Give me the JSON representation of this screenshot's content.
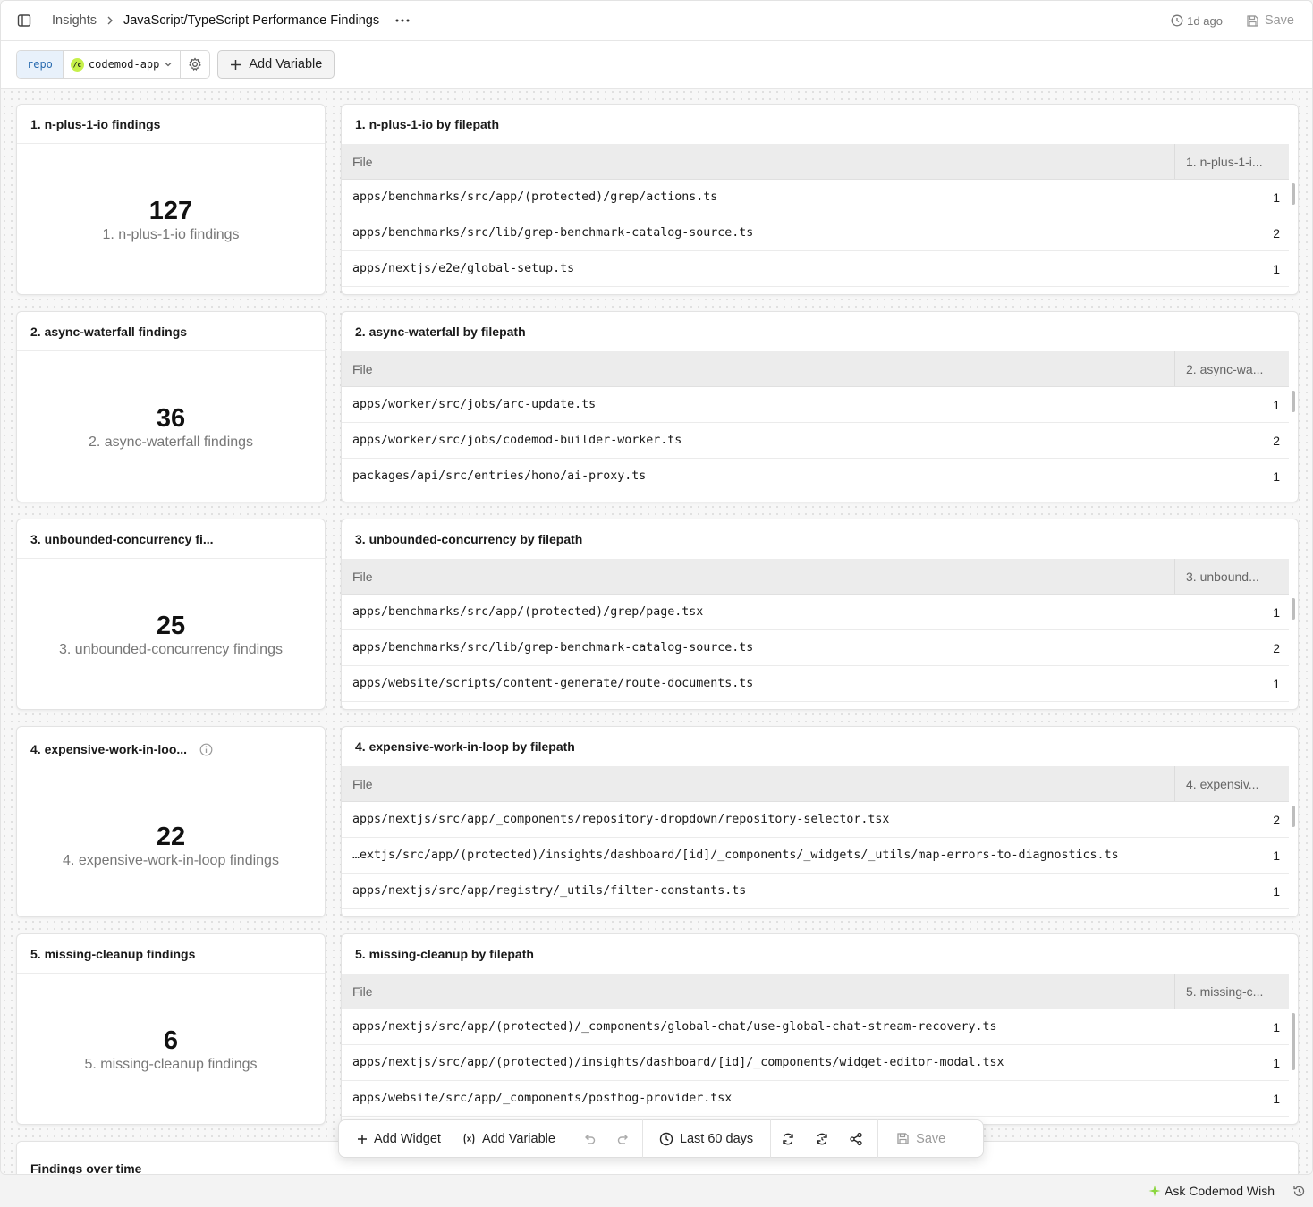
{
  "header": {
    "breadcrumb_root": "Insights",
    "title": "JavaScript/TypeScript Performance Findings",
    "last_saved": "1d ago",
    "save_label": "Save"
  },
  "variables": {
    "key": "repo",
    "value": "codemod-app",
    "add_label": "Add Variable"
  },
  "stats": [
    {
      "title": "1. n-plus-1-io findings",
      "value": "127",
      "label": "1. n-plus-1-io findings"
    },
    {
      "title": "2. async-waterfall findings",
      "value": "36",
      "label": "2. async-waterfall findings"
    },
    {
      "title": "3. unbounded-concurrency fi...",
      "value": "25",
      "label": "3. unbounded-concurrency findings"
    },
    {
      "title": "4. expensive-work-in-loo...",
      "value": "22",
      "label": "4. expensive-work-in-loop findings"
    },
    {
      "title": "5. missing-cleanup findings",
      "value": "6",
      "label": "5. missing-cleanup findings"
    }
  ],
  "tables": [
    {
      "title": "1. n-plus-1-io by filepath",
      "col_file": "File",
      "col_count": "1. n-plus-1-i...",
      "rows": [
        {
          "file": "apps/benchmarks/src/app/(protected)/grep/actions.ts",
          "count": "1"
        },
        {
          "file": "apps/benchmarks/src/lib/grep-benchmark-catalog-source.ts",
          "count": "2"
        },
        {
          "file": "apps/nextjs/e2e/global-setup.ts",
          "count": "1"
        }
      ]
    },
    {
      "title": "2. async-waterfall by filepath",
      "col_file": "File",
      "col_count": "2. async-wa...",
      "rows": [
        {
          "file": "apps/worker/src/jobs/arc-update.ts",
          "count": "1"
        },
        {
          "file": "apps/worker/src/jobs/codemod-builder-worker.ts",
          "count": "2"
        },
        {
          "file": "packages/api/src/entries/hono/ai-proxy.ts",
          "count": "1"
        }
      ]
    },
    {
      "title": "3. unbounded-concurrency by filepath",
      "col_file": "File",
      "col_count": "3. unbound...",
      "rows": [
        {
          "file": "apps/benchmarks/src/app/(protected)/grep/page.tsx",
          "count": "1"
        },
        {
          "file": "apps/benchmarks/src/lib/grep-benchmark-catalog-source.ts",
          "count": "2"
        },
        {
          "file": "apps/website/scripts/content-generate/route-documents.ts",
          "count": "1"
        }
      ]
    },
    {
      "title": "4. expensive-work-in-loop by filepath",
      "col_file": "File",
      "col_count": "4. expensiv...",
      "rows": [
        {
          "file": "apps/nextjs/src/app/_components/repository-dropdown/repository-selector.tsx",
          "count": "2"
        },
        {
          "file": "…extjs/src/app/(protected)/insights/dashboard/[id]/_components/_widgets/_utils/map-errors-to-diagnostics.ts",
          "count": "1"
        },
        {
          "file": "apps/nextjs/src/app/registry/_utils/filter-constants.ts",
          "count": "1"
        }
      ]
    },
    {
      "title": "5. missing-cleanup by filepath",
      "col_file": "File",
      "col_count": "5. missing-c...",
      "rows": [
        {
          "file": "apps/nextjs/src/app/(protected)/_components/global-chat/use-global-chat-stream-recovery.ts",
          "count": "1"
        },
        {
          "file": "apps/nextjs/src/app/(protected)/insights/dashboard/[id]/_components/widget-editor-modal.tsx",
          "count": "1"
        },
        {
          "file": "apps/website/src/app/_components/posthog-provider.tsx",
          "count": "1"
        }
      ]
    }
  ],
  "findings_over_time": {
    "title": "Findings over time"
  },
  "toolbar": {
    "add_widget": "Add Widget",
    "add_variable": "Add Variable",
    "time_range": "Last 60 days",
    "save": "Save"
  },
  "footer": {
    "ask_label": "Ask Codemod Wish",
    "accent": "#8bd63e"
  },
  "icons": [
    "sidebar-toggle-icon",
    "chevron-right-icon",
    "more-horizontal-icon",
    "clock-icon",
    "save-icon",
    "chevron-down-icon",
    "gear-icon",
    "plus-icon",
    "info-icon",
    "variable-icon",
    "undo-icon",
    "redo-icon",
    "refresh-icon",
    "auto-refresh-icon",
    "share-icon",
    "sparkle-icon",
    "history-icon"
  ]
}
